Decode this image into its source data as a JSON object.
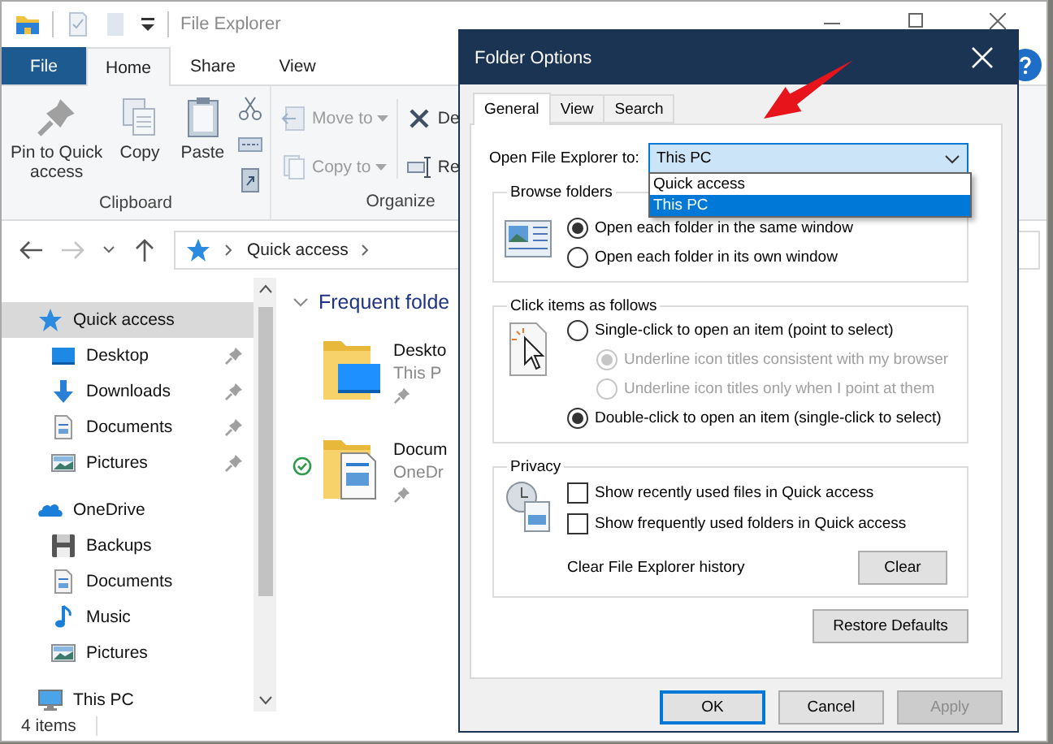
{
  "explorer": {
    "title": "File Explorer",
    "ribbon_tabs": [
      {
        "label": "File",
        "kind": "file",
        "selected": false
      },
      {
        "label": "Home",
        "kind": "tab",
        "selected": true
      },
      {
        "label": "Share",
        "kind": "tab",
        "selected": false
      },
      {
        "label": "View",
        "kind": "tab",
        "selected": false
      }
    ],
    "clipboard": {
      "label": "Clipboard",
      "pin": "Pin to Quick access",
      "copy": "Copy",
      "paste": "Paste"
    },
    "organize": {
      "label": "Organize",
      "move_to": {
        "label": "Move to",
        "disabled": true
      },
      "copy_to": {
        "label": "Copy to",
        "disabled": true
      },
      "delete": "De",
      "rename": "Re"
    },
    "address": {
      "crumbs": [
        "Quick access"
      ]
    },
    "nav": [
      {
        "label": "Quick access",
        "kind": "star",
        "selected": true,
        "children": [
          {
            "label": "Desktop",
            "kind": "desktop",
            "selected": false,
            "pinned": true
          },
          {
            "label": "Downloads",
            "kind": "downloads",
            "selected": false,
            "pinned": true
          },
          {
            "label": "Documents",
            "kind": "documents",
            "selected": false,
            "pinned": true
          },
          {
            "label": "Pictures",
            "kind": "pictures",
            "selected": false,
            "pinned": true
          }
        ]
      },
      {
        "label": "OneDrive",
        "kind": "cloud",
        "selected": false,
        "children": [
          {
            "label": "Backups",
            "kind": "floppy",
            "selected": false,
            "pinned": false
          },
          {
            "label": "Documents",
            "kind": "documents",
            "selected": false,
            "pinned": false
          },
          {
            "label": "Music",
            "kind": "music",
            "selected": false,
            "pinned": false
          },
          {
            "label": "Pictures",
            "kind": "pictures",
            "selected": false,
            "pinned": false
          }
        ]
      },
      {
        "label": "This PC",
        "kind": "pc",
        "selected": false
      }
    ],
    "section_title": "Frequent folde",
    "folders": [
      {
        "name": "Deskto",
        "location": "This P",
        "kind": "desktop",
        "synced": false
      },
      {
        "name": "Docum",
        "location": "OneDr",
        "kind": "documents",
        "synced": true
      }
    ],
    "status": "4 items"
  },
  "dialog": {
    "title": "Folder Options",
    "tabs": [
      {
        "label": "General",
        "selected": true
      },
      {
        "label": "View",
        "selected": false
      },
      {
        "label": "Search",
        "selected": false
      }
    ],
    "open_to": {
      "label": "Open File Explorer to:",
      "value": "This PC",
      "options": [
        {
          "label": "Quick access",
          "selected": false
        },
        {
          "label": "This PC",
          "selected": true
        }
      ]
    },
    "browse": {
      "title": "Browse folders",
      "options": [
        {
          "label": "Open each folder in the same window",
          "selected": true,
          "disabled": false
        },
        {
          "label": "Open each folder in its own window",
          "selected": false,
          "disabled": false
        }
      ]
    },
    "click": {
      "title": "Click items as follows",
      "options": [
        {
          "label": "Single-click to open an item (point to select)",
          "selected": false,
          "disabled": false,
          "children": [
            {
              "label": "Underline icon titles consistent with my browser",
              "selected": true,
              "disabled": true
            },
            {
              "label": "Underline icon titles only when I point at them",
              "selected": false,
              "disabled": true
            }
          ]
        },
        {
          "label": "Double-click to open an item (single-click to select)",
          "selected": true,
          "disabled": false
        }
      ]
    },
    "privacy": {
      "title": "Privacy",
      "checkboxes": [
        {
          "label": "Show recently used files in Quick access",
          "checked": false
        },
        {
          "label": "Show frequently used folders in Quick access",
          "checked": false
        }
      ],
      "clear_label": "Clear File Explorer history",
      "clear_button": "Clear"
    },
    "restore": "Restore Defaults",
    "buttons": [
      {
        "label": "OK",
        "kind": "default",
        "disabled": false
      },
      {
        "label": "Cancel",
        "kind": "normal",
        "disabled": false
      },
      {
        "label": "Apply",
        "kind": "normal",
        "disabled": true
      }
    ]
  }
}
